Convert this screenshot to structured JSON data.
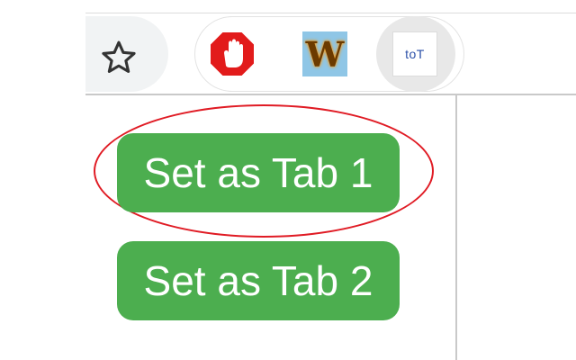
{
  "toolbar": {
    "bookmark_icon": "star-outline-icon",
    "extensions": [
      {
        "name": "adblock",
        "icon": "stop-hand-icon",
        "color": "#e21b1b"
      },
      {
        "name": "w-extension",
        "icon": "w-letter-icon",
        "letter": "W",
        "color": "#8fc6e6"
      },
      {
        "name": "tab-extension",
        "icon": "tot-icon",
        "letters": "toT",
        "color": "#2a4fa8"
      }
    ]
  },
  "popup": {
    "buttons": [
      {
        "label": "Set as Tab 1"
      },
      {
        "label": "Set as Tab 2"
      }
    ],
    "button_color": "#4cae4f",
    "highlight_color": "#e01b24"
  }
}
